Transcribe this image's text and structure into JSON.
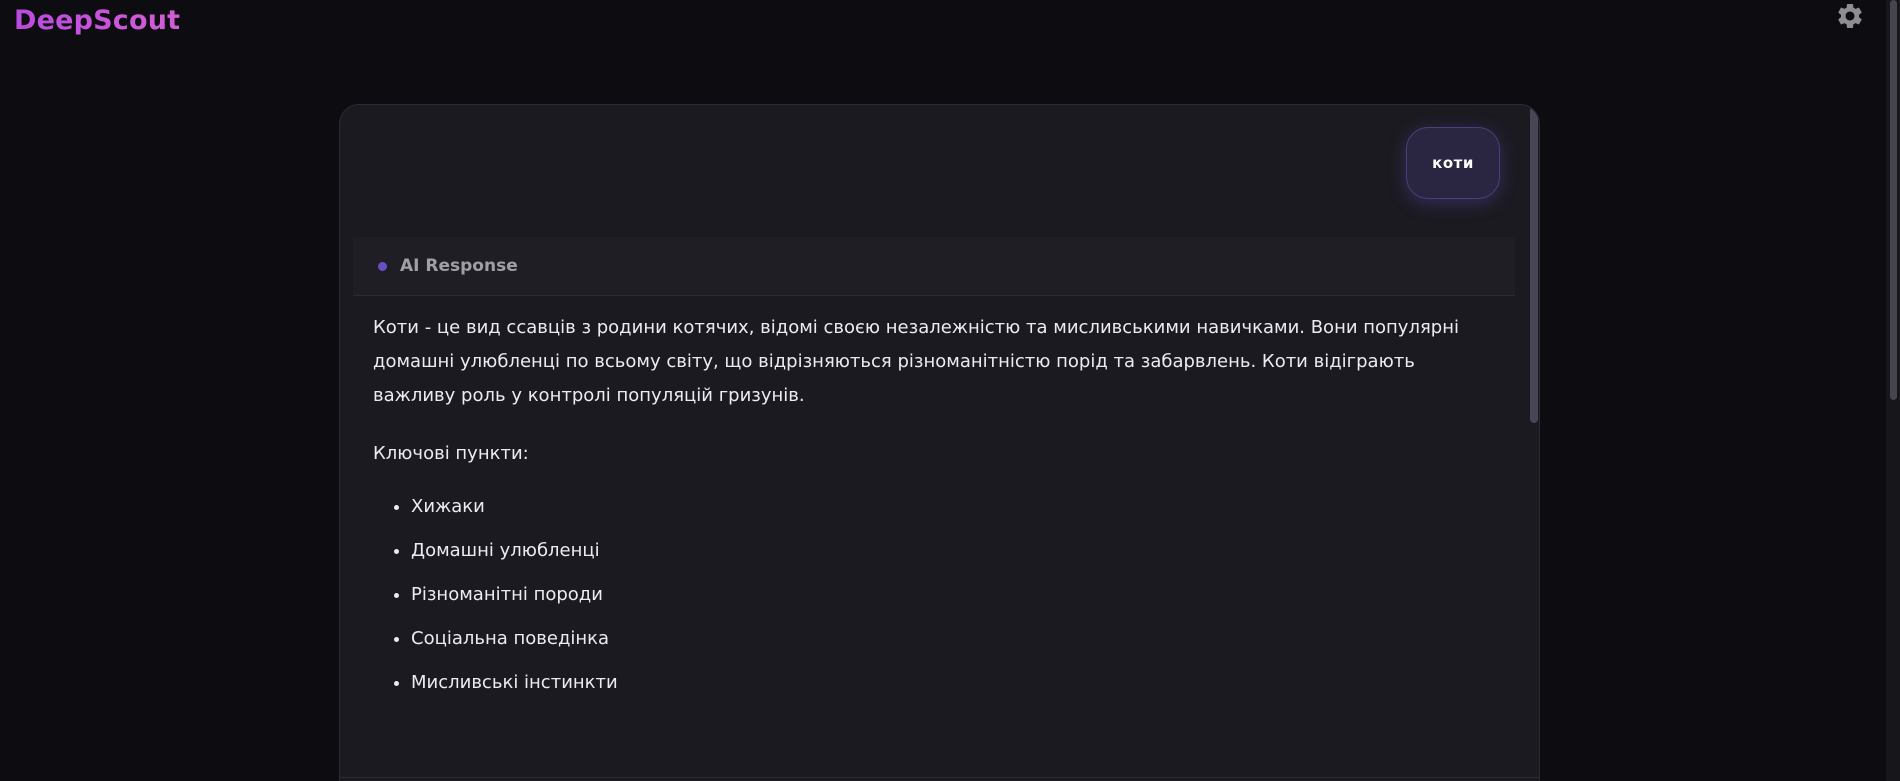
{
  "app": {
    "title": "DeepScout"
  },
  "header": {
    "settings_icon": "gear-icon"
  },
  "chat": {
    "user_message": "коти",
    "response": {
      "label": "AI Response",
      "paragraph": "Коти - це вид ссавців з родини котячих, відомі своєю незалежністю та мисливськими навичками. Вони популярні домашні улюбленці по всьому світу, що відрізняються різноманітністю порід та забарвлень. Коти відіграють важливу роль у контролі популяцій гризунів.",
      "key_points_heading": "Ключові пункти:",
      "key_points": [
        "Хижаки",
        "Домашні улюбленці",
        "Різноманітні породи",
        "Соціальна поведінка",
        "Мисливські інстинкти"
      ]
    }
  },
  "colors": {
    "background": "#0d0c10",
    "panel": "#1b1a20",
    "accent": "#c14ee0",
    "response_dot": "#6a4fc4",
    "user_bubble": "#2a2540"
  }
}
